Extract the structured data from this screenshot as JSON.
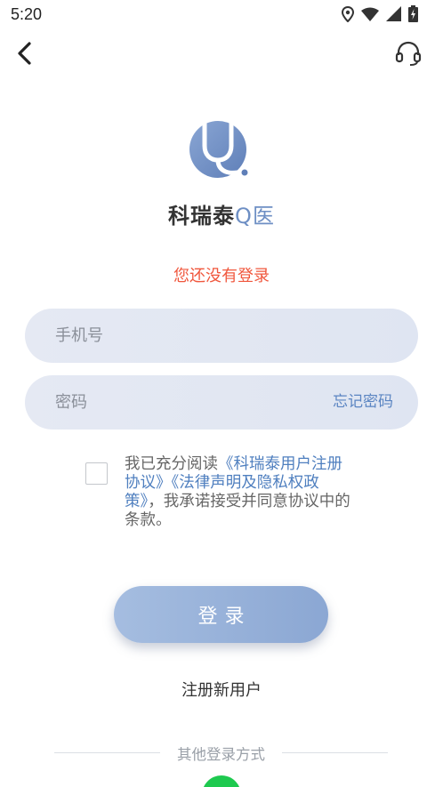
{
  "status_bar": {
    "time": "5:20",
    "icons": [
      "location-icon",
      "wifi-icon",
      "signal-icon",
      "battery-charging-icon"
    ]
  },
  "header": {
    "back_icon": "chevron-left-icon",
    "support_icon": "headset-icon"
  },
  "brand": {
    "logo_icon": "stethoscope-logo-icon",
    "name_main": "科瑞泰",
    "name_accent": "Q医",
    "logo_color": "#6e8fc4"
  },
  "login_status": "您还没有登录",
  "form": {
    "phone_placeholder": "手机号",
    "password_placeholder": "密码",
    "forgot_label": "忘记密码"
  },
  "agreement": {
    "prefix": "我已充分阅读",
    "link_user": "《科瑞泰用户注册协议》",
    "link_legal": "《法律声明及隐私权政策》",
    "suffix": "，我承诺接受并同意协议中的条款。",
    "checked": false
  },
  "login_button_label": "登录",
  "register_label": "注册新用户",
  "other_login_label": "其他登录方式",
  "colors": {
    "accent_blue": "#5b85c2",
    "warning_red": "#f0573d",
    "button_gradient_start": "#a5bde0",
    "button_gradient_end": "#8ba7d3",
    "wechat_green": "#1ec94f"
  }
}
